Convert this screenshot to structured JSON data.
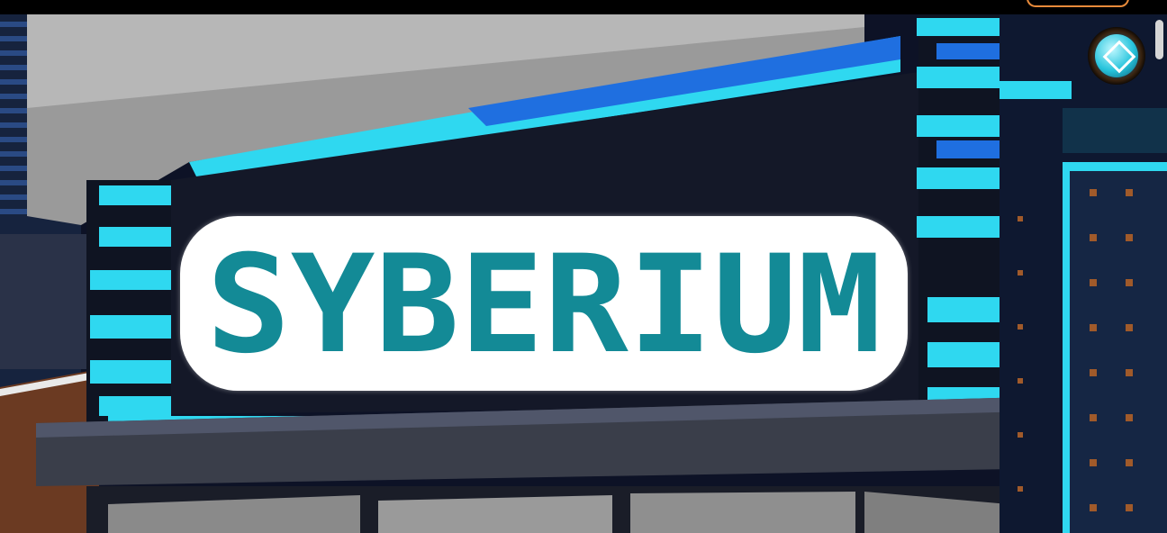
{
  "game": {
    "logo_text": "SYBERIUM"
  },
  "colors": {
    "logo_color": "#138a96",
    "panel_bg": "#ffffff",
    "neon_cyan": "#2fd8f0",
    "neon_blue": "#1f6fe0"
  },
  "icons": {
    "emblem": "emblem-icon"
  }
}
